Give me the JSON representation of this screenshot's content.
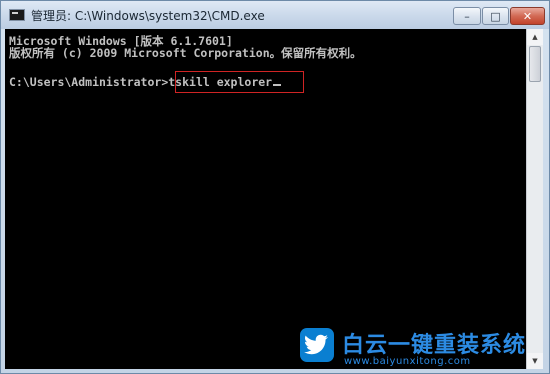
{
  "window": {
    "title": "管理员: C:\\Windows\\system32\\CMD.exe",
    "icon": "cmd-icon",
    "buttons": {
      "minimize_glyph": "–",
      "maximize_glyph": "□",
      "close_glyph": "✕"
    }
  },
  "console": {
    "line1": "Microsoft Windows [版本 6.1.7601]",
    "line2": "版权所有 (c) 2009 Microsoft Corporation。保留所有权利。",
    "prompt": "C:\\Users\\Administrator>",
    "command": "tskill explorer",
    "text_color": "#c0c0c0",
    "background": "#000000",
    "highlight_color": "#d02424"
  },
  "watermark": {
    "brand": "白云一键重装系统",
    "url": "www.baiyunxitong.com",
    "icon": "bird-icon",
    "color": "#2c8be3"
  }
}
